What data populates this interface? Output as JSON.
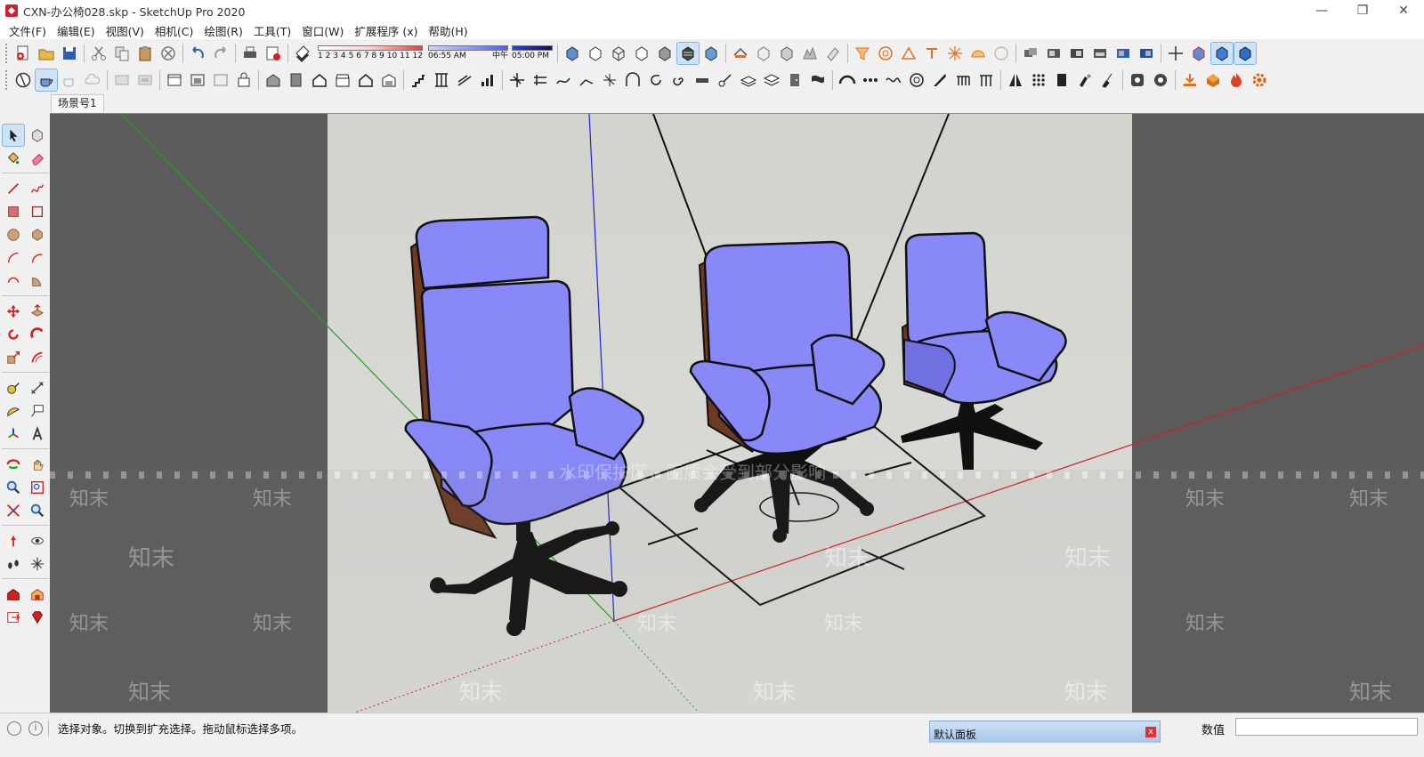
{
  "window": {
    "title": "CXN-办公椅028.skp - SketchUp Pro 2020",
    "minimize_glyph": "—",
    "restore_glyph": "❐",
    "close_glyph": "✕"
  },
  "menu": {
    "items": [
      "文件(F)",
      "编辑(E)",
      "视图(V)",
      "相机(C)",
      "绘图(R)",
      "工具(T)",
      "窗口(W)",
      "扩展程序 (x)",
      "帮助(H)"
    ]
  },
  "shadow_settings": {
    "scale_numbers": [
      "1",
      "2",
      "3",
      "4",
      "5",
      "6",
      "7",
      "8",
      "9",
      "10",
      "11",
      "12"
    ],
    "time_start": "06:55 AM",
    "time_mid": "中午",
    "time_end": "05:00 PM"
  },
  "scenes": {
    "tabs": [
      "场景号1"
    ]
  },
  "viewport": {
    "watermark_banner": "水印保护区，画质会受到部分影响",
    "watermark_brand": "知末",
    "colors": {
      "background": "#5c5c5c",
      "ground": "#d6d6d2",
      "chair_fabric": "#8888f8",
      "chair_shell": "#6e3a22",
      "axis_red": "#d02020",
      "axis_green": "#1fa01f",
      "axis_blue": "#2020e0"
    }
  },
  "status": {
    "info_icon": "i",
    "hint": "选择对象。切换到扩充选择。拖动鼠标选择多项。",
    "tray_title": "默认面板",
    "tray_close": "x",
    "measurements_label": "数值",
    "measurements_value": ""
  }
}
